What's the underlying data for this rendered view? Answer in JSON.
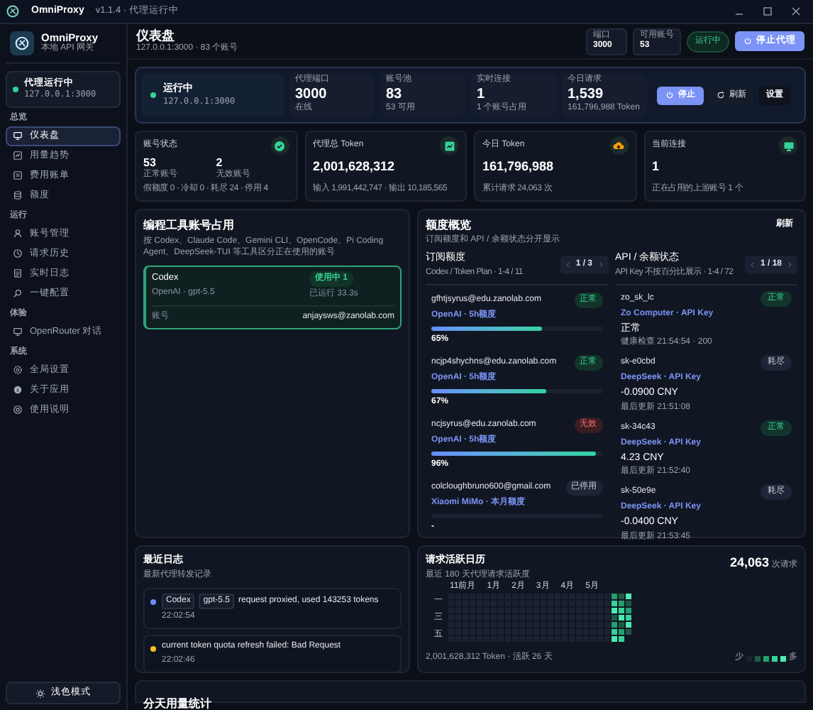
{
  "titlebar": {
    "app": "OmniProxy",
    "version": "v1.1.4 · 代理运行中"
  },
  "sidebar": {
    "brand": "OmniProxy",
    "brand_sub": "本地 API 网关",
    "status": {
      "label": "代理运行中",
      "address": "127.0.0.1:3000",
      "on": true
    },
    "sections": [
      {
        "label": "总览",
        "items": [
          {
            "label": "仪表盘",
            "selected": true
          },
          {
            "label": "用量趋势",
            "selected": false
          },
          {
            "label": "费用账单",
            "selected": false
          },
          {
            "label": "额度",
            "selected": false
          }
        ]
      },
      {
        "label": "运行",
        "items": [
          {
            "label": "账号管理",
            "selected": false
          },
          {
            "label": "请求历史",
            "selected": false
          },
          {
            "label": "实时日志",
            "selected": false
          },
          {
            "label": "一键配置",
            "selected": false
          }
        ]
      },
      {
        "label": "体验",
        "items": [
          {
            "label": "OpenRouter 对话",
            "selected": false
          }
        ]
      },
      {
        "label": "系统",
        "items": [
          {
            "label": "全局设置",
            "selected": false
          },
          {
            "label": "关于应用",
            "selected": false
          },
          {
            "label": "使用说明",
            "selected": false
          }
        ]
      }
    ],
    "theme_button": "浅色模式"
  },
  "header": {
    "title": "仪表盘",
    "subtitle": "127.0.0.1:3000 · 83 个账号",
    "chips": [
      {
        "label": "端口",
        "value": "3000"
      },
      {
        "label": "可用账号",
        "value": "53"
      }
    ],
    "status_badge": "运行中",
    "stop_button": "停止代理"
  },
  "running_card": {
    "status": "运行中",
    "address": "127.0.0.1:3000",
    "stats": [
      {
        "label": "代理端口",
        "value": "3000",
        "sub": "在线"
      },
      {
        "label": "账号池",
        "value": "83",
        "sub": "53 可用"
      },
      {
        "label": "实时连接",
        "value": "1",
        "sub": "1 个账号占用"
      },
      {
        "label": "今日请求",
        "value": "1,539",
        "sub": "161,796,988 Token"
      }
    ],
    "buttons": {
      "stop": "停止",
      "refresh": "刷新",
      "settings": "设置"
    }
  },
  "stat_cards": [
    {
      "kind": "split",
      "title": "账号状态",
      "color": "#34d399",
      "parts": [
        {
          "value": "53",
          "label": "正常账号"
        },
        {
          "value": "2",
          "label": "无效账号"
        }
      ],
      "note": "假额度 0 · 冷却 0 · 耗尽 24 · 停用 4"
    },
    {
      "kind": "single",
      "title": "代理总 Token",
      "color": "#34d399",
      "value": "2,001,628,312",
      "note": "输入 1,991,442,747 · 输出 10,185,565"
    },
    {
      "kind": "single",
      "title": "今日 Token",
      "color": "#f59e0b",
      "value": "161,796,988",
      "note": "累计请求 24,063 次"
    },
    {
      "kind": "single",
      "title": "当前连接",
      "color": "#34d399",
      "value": "1",
      "note": "正在占用的上游账号 1 个"
    }
  ],
  "tools_panel": {
    "title": "编程工具账号占用",
    "description": "按 Codex、Claude Code、Gemini CLI、OpenCode、Pi Coding Agent、DeepSeek-TUI 等工具区分正在使用的账号",
    "cards": [
      {
        "tool": "Codex",
        "model": "OpenAI · gpt-5.5",
        "badge": "使用中 1",
        "elapsed": "已运行 33.3s",
        "account_label": "账号",
        "account": "anjaysws@zanolab.com"
      }
    ]
  },
  "quota_panel": {
    "title": "额度概览",
    "subtitle": "订阅额度和 API / 余额状态分开显示",
    "refresh": "刷新",
    "subscription": {
      "title": "订阅额度",
      "subtitle": "Codex / Token Plan · 1-4 / 11",
      "page": "1 / 3",
      "items": [
        {
          "account": "gfhtjsyrus@edu.zanolab.com",
          "plan": "OpenAI · 5h额度",
          "status": "正常",
          "kind": "normal",
          "level": 0.65,
          "percent": "65%"
        },
        {
          "account": "ncjp4shychns@edu.zanolab.com",
          "plan": "OpenAI · 5h额度",
          "status": "正常",
          "kind": "normal",
          "level": 0.67,
          "percent": "67%"
        },
        {
          "account": "ncjsyrus@edu.zanolab.com",
          "plan": "OpenAI · 5h额度",
          "status": "无效",
          "kind": "invalid",
          "level": 0.96,
          "percent": "96%"
        },
        {
          "account": "colcloughbruno600@gmail.com",
          "plan": "Xiaomi MiMo · 本月额度",
          "status": "已停用",
          "kind": "disabled",
          "level": 0,
          "percent": "-"
        }
      ]
    },
    "api": {
      "title": "API / 余额状态",
      "subtitle": "API Key 不按百分比展示 · 1-4 / 72",
      "page": "1 / 18",
      "items": [
        {
          "name": "zo_sk_lc",
          "provider": "Zo Computer · API Key",
          "value": "正常",
          "note": "健康检查 21:54:54 · 200",
          "status": "正常",
          "kind": "normal"
        },
        {
          "name": "sk-e0cbd",
          "provider": "DeepSeek · API Key",
          "value": "-0.0900 CNY",
          "note": "最后更新 21:51:08",
          "status": "耗尽",
          "kind": "exhausted"
        },
        {
          "name": "sk-34c43",
          "provider": "DeepSeek · API Key",
          "value": "4.23 CNY",
          "note": "最后更新 21:52:40",
          "status": "正常",
          "kind": "normal"
        },
        {
          "name": "sk-50e9e",
          "provider": "DeepSeek · API Key",
          "value": "-0.0400 CNY",
          "note": "最后更新 21:53:45",
          "status": "耗尽",
          "kind": "exhausted"
        }
      ]
    }
  },
  "logs_panel": {
    "title": "最近日志",
    "subtitle": "最新代理转发记录",
    "entries": [
      {
        "color": "#6b8cff",
        "tags": [
          "Codex",
          "gpt-5.5"
        ],
        "message": "request proxied, used 143253 tokens",
        "time": "22:02:54"
      },
      {
        "color": "#fbbf24",
        "message": "current token quota refresh failed: Bad Request",
        "time": "22:02:46"
      }
    ]
  },
  "activity_panel": {
    "title": "请求活跃日历",
    "subtitle": "最近 180 天代理请求活跃度",
    "total": "24,063",
    "total_unit": "次请求",
    "months": [
      "11前月",
      "1月",
      "2月",
      "3月",
      "4月",
      "5月"
    ],
    "weekdays": [
      "一",
      "三",
      "五"
    ],
    "footer": "2,001,628,312 Token · 活跃 26 天",
    "legend_less": "少",
    "legend_more": "多"
  },
  "daily_panel": {
    "title": "分天用量统计"
  }
}
